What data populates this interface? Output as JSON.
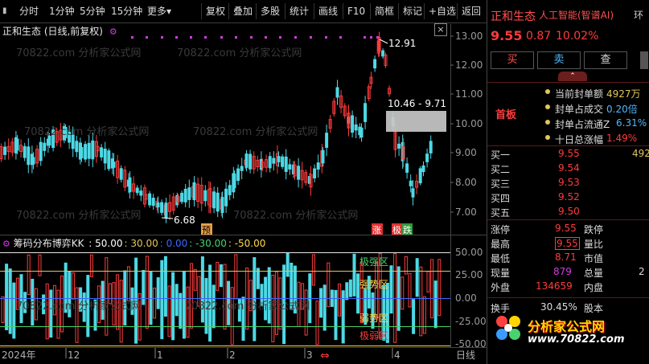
{
  "colors": {
    "up": "#ff3b3b",
    "down": "#4dd9e6",
    "bg": "#000000",
    "axis": "#9a9a9a",
    "magenta": "#d13be0",
    "gold": "#e0c75a",
    "green": "#49d36e",
    "blue": "#3b67ff"
  },
  "toolbar": {
    "left": [
      {
        "label": "分时"
      },
      {
        "label": "1分钟"
      },
      {
        "label": "5分钟"
      },
      {
        "label": "15分钟"
      },
      {
        "label": "更多"
      }
    ],
    "more_arrow": "▾",
    "right": [
      {
        "label": "复权"
      },
      {
        "label": "叠加"
      },
      {
        "label": "多股"
      },
      {
        "label": "统计"
      },
      {
        "label": "画线"
      },
      {
        "label": "F10"
      },
      {
        "label": "简框"
      },
      {
        "label": "标记"
      },
      {
        "label": "+自选"
      },
      {
        "label": "返回"
      }
    ]
  },
  "chart_header": {
    "title": "正和生态 (日线,前复权)",
    "icon": "settings-icon",
    "close": "×"
  },
  "price_axis": {
    "labels": [
      "13.00",
      "12.00",
      "11.00",
      "10.00",
      "9.00",
      "8.00",
      "7.00"
    ]
  },
  "annotations": {
    "high": "12.91",
    "low": "6.68",
    "box": "10.46 - 9.71",
    "tag_yu": "预",
    "tag_zhang": "涨",
    "tag_ji": "极",
    "tag_die": "跌"
  },
  "indicator": {
    "title": "筹码分布博弈K",
    "values": [
      {
        "text": ": 50.00",
        "color": "#ffffff"
      },
      {
        "text": ": 30.00",
        "color": "#e0c75a"
      },
      {
        "text": ": 0.00",
        "color": "#3b67ff"
      },
      {
        "text": ": -30.00",
        "color": "#49d36e"
      },
      {
        "text": ": -50.00",
        "color": "#ffd84a"
      }
    ],
    "axis": [
      "50.00",
      "25.00",
      "0.00",
      "-25.00",
      "-50.00"
    ],
    "zones": {
      "very_strong": "极强区",
      "strong": "强势区",
      "weak": "弱势区",
      "very_weak": "极弱区"
    }
  },
  "timeline": {
    "labels": [
      "2024年",
      "12",
      "1",
      "2",
      "3",
      "4"
    ],
    "period": "日线",
    "scroll": "⇔"
  },
  "panel": {
    "name": "正和生态",
    "sector": "人工智能(智谱AI)",
    "extra": "环",
    "price": "9.55",
    "change": "0.87",
    "pct": "10.02%",
    "buy": "买",
    "sell": "卖",
    "view": "查",
    "limit_label": "首板",
    "limit_rows": [
      {
        "label": "当前封单额",
        "value": "4927万",
        "color": "#e0c75a"
      },
      {
        "label": "封单占成交",
        "value": "0.20倍",
        "color": "#4db8ff"
      },
      {
        "label": "封单占流通Z",
        "value": "6.31%",
        "color": "#4db8ff"
      },
      {
        "label": "十日总涨幅",
        "value": "1.49%",
        "color": "#ff3b3b"
      }
    ],
    "levels": [
      {
        "name": "买一",
        "price": "9.55",
        "vol": "492"
      },
      {
        "name": "买二",
        "price": "9.54",
        "vol": ""
      },
      {
        "name": "买三",
        "price": "9.53",
        "vol": ""
      },
      {
        "name": "买四",
        "price": "9.52",
        "vol": ""
      },
      {
        "name": "买五",
        "price": "9.50",
        "vol": ""
      }
    ],
    "stats": [
      {
        "l": "涨停",
        "v": "9.55",
        "l2": "跌停",
        "v2": ""
      },
      {
        "l": "最高",
        "v": "9.55",
        "l2": "量比",
        "v2": ""
      },
      {
        "l": "最低",
        "v": "8.71",
        "l2": "市值",
        "v2": ""
      },
      {
        "l": "现量",
        "v": "879",
        "l2": "总量",
        "v2": "2"
      },
      {
        "l": "外盘",
        "v": "134659",
        "l2": "内盘",
        "v2": ""
      }
    ],
    "turnover_label": "换手",
    "turnover": "30.45%",
    "equity_label": "股本"
  },
  "watermark": {
    "brand": "分析家公式网",
    "url": "www.70822.com",
    "repeat": "70822.com  分析家公式网"
  }
}
